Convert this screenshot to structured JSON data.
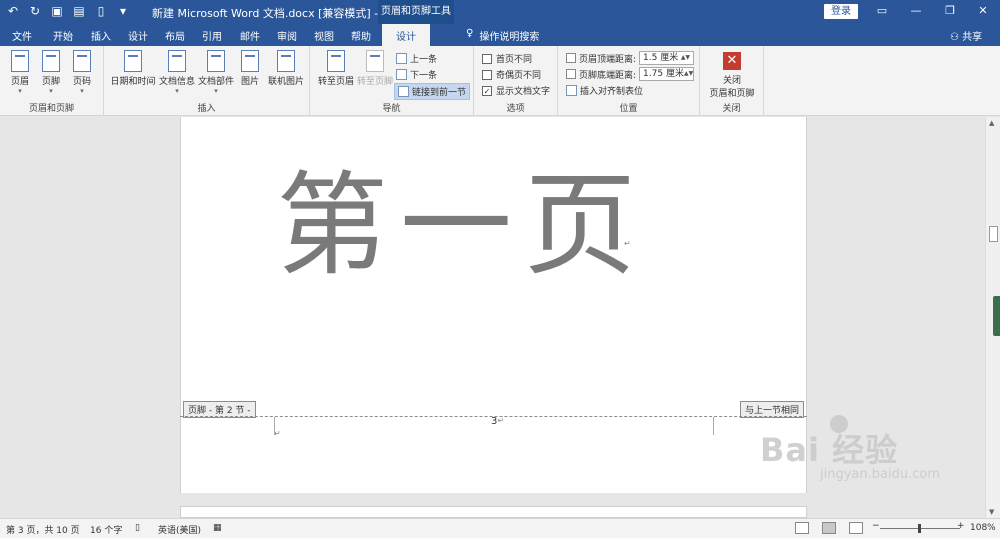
{
  "titlebar": {
    "doc_title": "新建 Microsoft Word 文档.docx [兼容模式] - Word",
    "context_tools": "页眉和页脚工具",
    "login": "登录",
    "qat_icons": [
      "undo-icon",
      "redo-icon",
      "save-icon",
      "print-icon",
      "new-doc-icon",
      "customize-icon"
    ]
  },
  "tabs": {
    "items": [
      "文件",
      "开始",
      "插入",
      "设计",
      "布局",
      "引用",
      "邮件",
      "审阅",
      "视图",
      "帮助"
    ],
    "active": "设计",
    "search": "操作说明搜索",
    "share": "共享"
  },
  "ribbon": {
    "group1": {
      "label": "页眉和页脚",
      "buttons": [
        "页眉",
        "页脚",
        "页码"
      ]
    },
    "group2": {
      "label": "插入",
      "buttons": [
        "日期和时间",
        "文档信息",
        "文档部件",
        "图片",
        "联机图片"
      ]
    },
    "group3": {
      "label": "导航",
      "goto_header": "转至页眉",
      "goto_footer": "转至页脚",
      "prev": "上一条",
      "next": "下一条",
      "link_prev": "链接到前一节"
    },
    "group4": {
      "label": "选项",
      "different_first": "首页不同",
      "different_odd_even": "奇偶页不同",
      "show_doc_text": "显示文档文字"
    },
    "group5": {
      "label": "位置",
      "header_top_label": "页眉顶端距离:",
      "header_top_value": "1.5 厘米",
      "footer_bottom_label": "页脚底端距离:",
      "footer_bottom_value": "1.75 厘米",
      "insert_align_tab": "插入对齐制表位"
    },
    "group6": {
      "label": "关闭",
      "close_line1": "关闭",
      "close_line2": "页眉和页脚"
    }
  },
  "document": {
    "big_text": "第一页",
    "footer_tag": "页脚 - 第 2 节 -",
    "same_as_previous": "与上一节相同",
    "page_number": "3"
  },
  "status": {
    "page_info": "第 3 页，共 10 页",
    "word_count": "16 个字",
    "language": "英语(美国)",
    "zoom": "108%"
  },
  "watermark": {
    "main": "Bai 经验",
    "sub": "jingyan.baidu.com"
  }
}
